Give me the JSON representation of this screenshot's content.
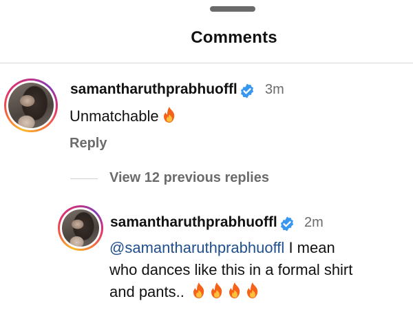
{
  "header": {
    "title": "Comments"
  },
  "comment": {
    "username": "samantharuthprabhuoffl",
    "time": "3m",
    "text": "Unmatchable",
    "emoji_count": 1,
    "reply_label": "Reply"
  },
  "replies": {
    "view_label": "View 12 previous replies"
  },
  "reply": {
    "username": "samantharuthprabhuoffl",
    "time": "2m",
    "mention": "@samantharuthprabhuoffl",
    "text_line1": "I mean",
    "text_line2": "who dances like this in a formal shirt",
    "text_line3": "and pants..",
    "emoji_count": 4
  },
  "colors": {
    "verified_blue": "#3897f0",
    "mention_blue": "#1f4f8e",
    "muted_gray": "#6b6b6b",
    "fire_orange": "#f5631a"
  },
  "icons": {
    "verified": "verified-badge-icon",
    "fire": "fire-icon"
  }
}
